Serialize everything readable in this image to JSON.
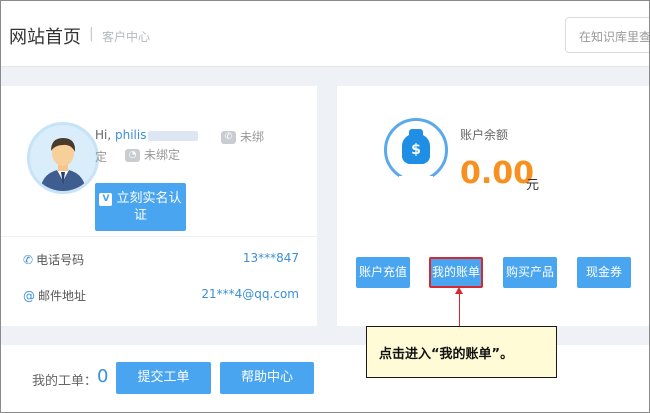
{
  "header": {
    "title": "网站首页",
    "separator": "|",
    "subtitle": "客户中心",
    "search_placeholder": "在知识库里查"
  },
  "profile": {
    "greeting": "Hi,",
    "username": "philis",
    "phone_status": "未绑",
    "phone_status_wrap": "定",
    "wechat_status": "未绑定",
    "verify_button": "立刻实名认证",
    "contact_rows": [
      {
        "label": "电话号码",
        "value": "13***847"
      },
      {
        "label": "邮件地址",
        "value": "21***4@qq.com"
      }
    ]
  },
  "account": {
    "balance_label": "账户余额",
    "balance_value": "0.00",
    "balance_unit": "元",
    "actions": [
      {
        "label": "账户充值"
      },
      {
        "label": "我的账单"
      },
      {
        "label": "购买产品"
      },
      {
        "label": "现金券"
      }
    ]
  },
  "tickets": {
    "label": "我的工单：",
    "count": "0",
    "submit_button": "提交工单",
    "help_button": "帮助中心"
  },
  "callout": {
    "text": "点击进入“我的账单”。"
  },
  "colors": {
    "accent": "#49a5ef",
    "highlight_border": "#d9272e",
    "balance": "#f7901e",
    "callout_bg": "#fffbd6"
  },
  "icons": {
    "avatar": "user-avatar",
    "phone": "phone-icon",
    "wechat": "wechat-icon",
    "email": "at-icon",
    "wallet": "money-bag-icon"
  }
}
